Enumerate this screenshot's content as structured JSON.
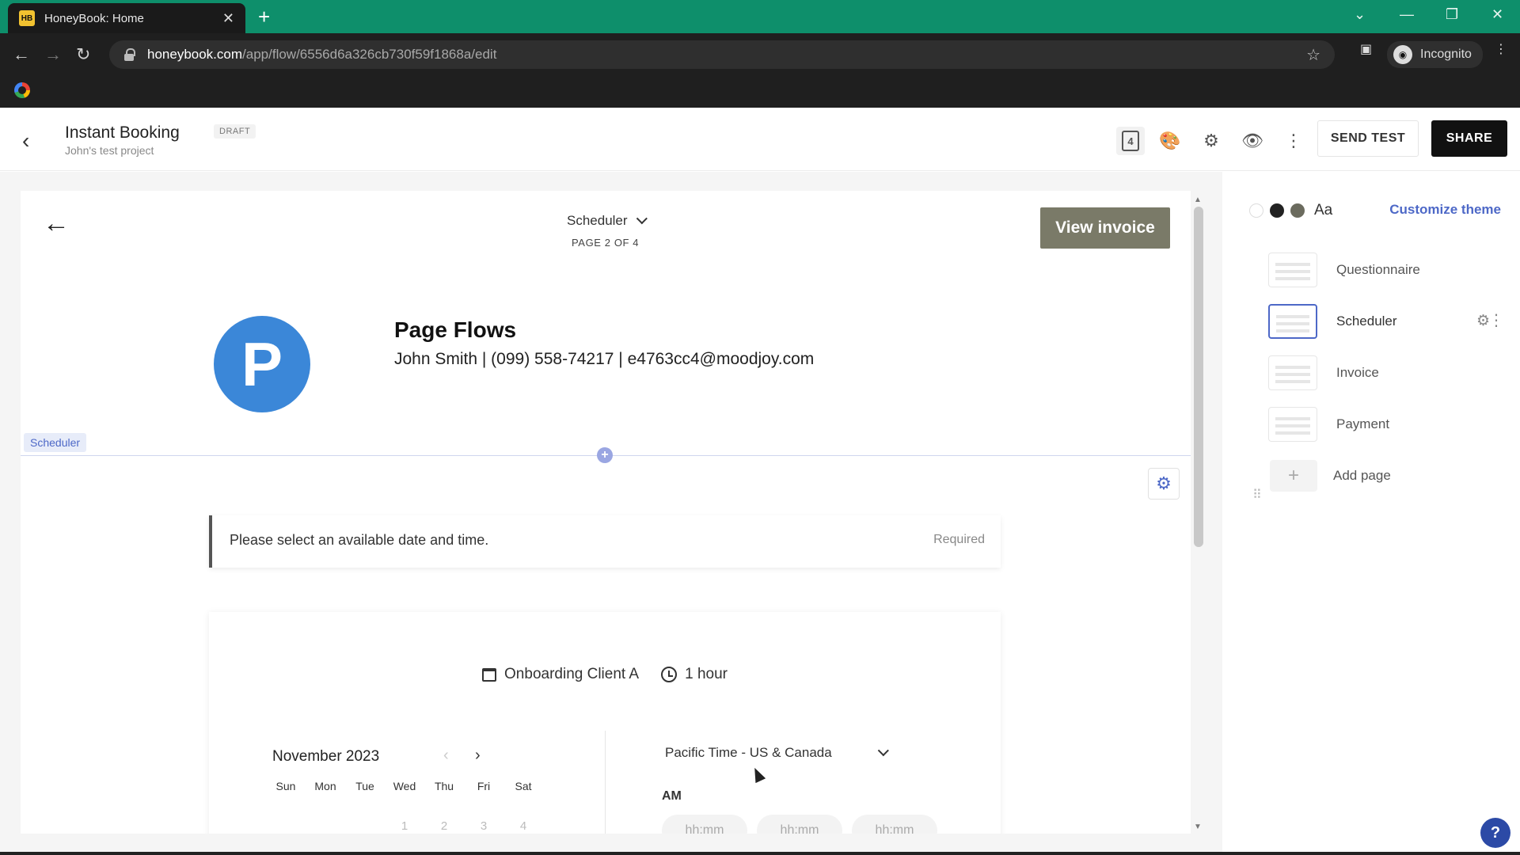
{
  "browser": {
    "tab_title": "HoneyBook: Home",
    "tab_favicon": "HB",
    "url_host": "honeybook.com",
    "url_path": "/app/flow/6556d6a326cb730f59f1868a/edit",
    "profile_label": "Incognito"
  },
  "header": {
    "title": "Instant Booking",
    "subtitle": "John's test project",
    "status_badge": "DRAFT",
    "pages_count": "4",
    "send_test_label": "SEND TEST",
    "share_label": "SHARE"
  },
  "page": {
    "page_selector": "Scheduler",
    "page_indicator": "PAGE 2 OF 4",
    "view_invoice_label": "View invoice",
    "logo_letter": "P",
    "business_name": "Page Flows",
    "business_contact": "John Smith | (099) 558-74217 | e4763cc4@moodjoy.com",
    "section_tag": "Scheduler",
    "notice_text": "Please select an available date and time.",
    "notice_required": "Required",
    "meeting_name": "Onboarding Client A",
    "meeting_duration": "1 hour",
    "month_label": "November 2023",
    "weekdays": [
      "Sun",
      "Mon",
      "Tue",
      "Wed",
      "Thu",
      "Fri",
      "Sat"
    ],
    "first_week_days": [
      "1",
      "2",
      "3",
      "4"
    ],
    "timezone": "Pacific Time - US & Canada",
    "period_label": "AM",
    "time_slots": [
      "hh:mm",
      "hh:mm",
      "hh:mm"
    ],
    "accent_color": "#4d68c7",
    "button_color": "#7a7a68",
    "logo_color": "#3b87d8"
  },
  "sidebar": {
    "theme_aa": "Aa",
    "customize_label": "Customize theme",
    "swatches": [
      "#ffffff",
      "#222222",
      "#6b6b5e"
    ],
    "pages": [
      {
        "label": "Questionnaire",
        "active": false
      },
      {
        "label": "Scheduler",
        "active": true
      },
      {
        "label": "Invoice",
        "active": false
      },
      {
        "label": "Payment",
        "active": false
      }
    ],
    "add_page_label": "Add page"
  },
  "help_label": "?"
}
